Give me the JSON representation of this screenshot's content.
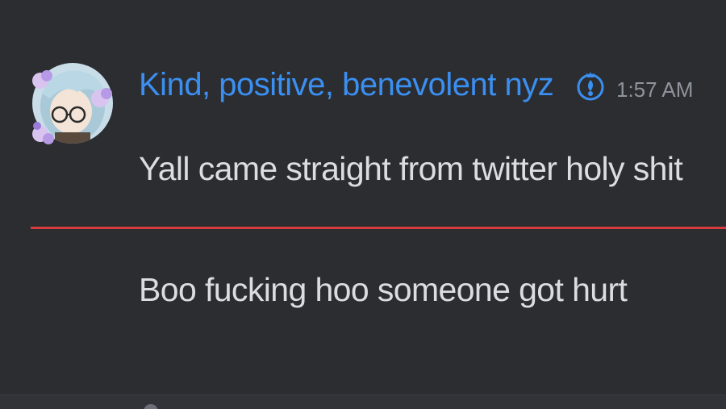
{
  "message": {
    "author": "Kind, positive, benevolent nyz",
    "timestamp": "1:57 AM",
    "avatar_icon": "anime-character-avatar-icon",
    "role_icon": "blue-role-badge-icon",
    "lines": [
      "Yall came straight from twitter holy shit",
      "Boo fucking hoo someone got hurt"
    ]
  },
  "colors": {
    "background": "#2b2d31",
    "username": "#3b8ff0",
    "text": "#dbdee1",
    "timestamp": "#8f939b",
    "new_messages_divider": "#d83c3e"
  }
}
